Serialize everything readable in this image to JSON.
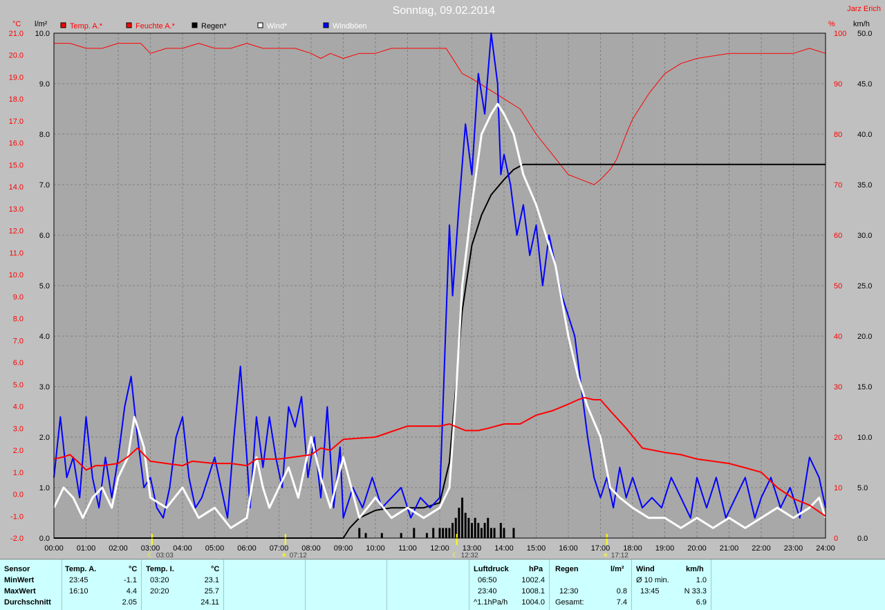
{
  "title": "Sonntag, 09.02.2014",
  "author": "Jarz Erich",
  "units": {
    "left1": "°C",
    "left2": "l/m²",
    "right1": "%",
    "right2": "km/h"
  },
  "legend": [
    {
      "label": "Temp. A.*",
      "color": "#ff0000"
    },
    {
      "label": "Feuchte A.*",
      "color": "#ff0000"
    },
    {
      "label": "Regen*",
      "color": "#000000"
    },
    {
      "label": "Wind*",
      "color": "#ffffff"
    },
    {
      "label": "Windböen",
      "color": "#0000ff"
    }
  ],
  "markers": [
    {
      "time": "03:03",
      "h": 3.05,
      "symbol": "moon"
    },
    {
      "time": "07:12",
      "h": 7.2,
      "symbol": "sun"
    },
    {
      "time": "12:32",
      "h": 12.53,
      "symbol": "moon"
    },
    {
      "time": "17:12",
      "h": 17.2,
      "symbol": "sun"
    }
  ],
  "chart_data": {
    "type": "line",
    "x_axis": {
      "label": "",
      "ticks": [
        "00:00",
        "01:00",
        "02:00",
        "03:00",
        "04:00",
        "05:00",
        "06:00",
        "07:00",
        "08:00",
        "09:00",
        "10:00",
        "11:00",
        "12:00",
        "13:00",
        "14:00",
        "15:00",
        "16:00",
        "17:00",
        "18:00",
        "19:00",
        "20:00",
        "21:00",
        "22:00",
        "23:00",
        "24:00"
      ],
      "range": [
        0,
        24
      ]
    },
    "axes": {
      "temp": {
        "unit": "°C",
        "range": [
          -2.0,
          21.0
        ],
        "ticks": [
          "21.0",
          "20.0",
          "19.0",
          "18.0",
          "17.0",
          "16.0",
          "15.0",
          "14.0",
          "13.0",
          "12.0",
          "11.0",
          "10.0",
          "9.0",
          "8.0",
          "7.0",
          "6.0",
          "5.0",
          "4.0",
          "3.0",
          "2.0",
          "1.0",
          "0.0",
          "-1.0",
          "-2.0"
        ]
      },
      "rain": {
        "unit": "l/m²",
        "range": [
          0.0,
          10.0
        ],
        "ticks": [
          "10.0",
          "9.0",
          "8.0",
          "7.0",
          "6.0",
          "5.0",
          "4.0",
          "3.0",
          "2.0",
          "1.0",
          "0.0"
        ]
      },
      "humidity": {
        "unit": "%",
        "range": [
          0,
          100
        ],
        "ticks": [
          "100",
          "90",
          "80",
          "70",
          "60",
          "50",
          "40",
          "30",
          "20",
          "10",
          "0"
        ]
      },
      "wind": {
        "unit": "km/h",
        "range": [
          0.0,
          50.0
        ],
        "ticks": [
          "50.0",
          "45.0",
          "40.0",
          "35.0",
          "30.0",
          "25.0",
          "20.0",
          "15.0",
          "10.0",
          "5.0",
          "0.0"
        ]
      }
    },
    "grid": true,
    "series": [
      {
        "name": "Temp. A.*",
        "axis": "temp",
        "color": "#ff0000",
        "x": [
          0,
          0.3,
          0.5,
          0.8,
          1.0,
          1.3,
          1.5,
          2.0,
          2.3,
          2.6,
          3.0,
          3.5,
          4.0,
          4.3,
          5.0,
          5.5,
          6.0,
          6.3,
          6.6,
          7.0,
          7.5,
          8.0,
          8.3,
          8.6,
          9.0,
          10.0,
          11.0,
          12.0,
          12.3,
          12.8,
          13.2,
          13.5,
          14.0,
          14.5,
          15.0,
          15.5,
          16.0,
          16.3,
          16.5,
          16.8,
          17.0,
          17.3,
          17.8,
          18.3,
          19.0,
          19.5,
          20.0,
          21.0,
          21.5,
          22.0,
          22.5,
          23.0,
          23.5,
          24.0
        ],
        "y": [
          1.6,
          1.7,
          1.8,
          1.4,
          1.1,
          1.3,
          1.3,
          1.4,
          1.7,
          2.1,
          1.5,
          1.4,
          1.3,
          1.5,
          1.4,
          1.4,
          1.3,
          1.6,
          1.6,
          1.6,
          1.7,
          1.8,
          2.1,
          2.0,
          2.5,
          2.6,
          3.1,
          3.1,
          3.2,
          2.9,
          2.9,
          3.0,
          3.2,
          3.2,
          3.6,
          3.8,
          4.1,
          4.3,
          4.4,
          4.3,
          4.3,
          3.8,
          3.0,
          2.1,
          1.9,
          1.8,
          1.6,
          1.4,
          1.2,
          1.0,
          0.3,
          -0.2,
          -0.5,
          -1.0
        ]
      },
      {
        "name": "Feuchte A.*",
        "axis": "humidity",
        "color": "#ff0000",
        "x": [
          0,
          0.5,
          1.0,
          1.5,
          2.0,
          2.5,
          2.7,
          3.0,
          3.5,
          4.0,
          4.5,
          5.0,
          5.5,
          6.0,
          6.5,
          7.0,
          7.5,
          8.0,
          8.3,
          8.6,
          9.0,
          9.5,
          10.0,
          10.5,
          11.0,
          11.5,
          12.0,
          12.2,
          12.5,
          12.7,
          13.0,
          13.5,
          14.0,
          14.5,
          15.0,
          15.5,
          16.0,
          16.4,
          16.8,
          17.0,
          17.3,
          17.5,
          17.8,
          18.0,
          18.5,
          19.0,
          19.5,
          20.0,
          21.0,
          22.0,
          23.0,
          23.5,
          24.0
        ],
        "y": [
          98,
          98,
          97,
          97,
          98,
          98,
          98,
          96,
          97,
          97,
          98,
          97,
          97,
          98,
          97,
          97,
          97,
          96,
          95,
          96,
          95,
          96,
          96,
          97,
          97,
          97,
          97,
          97,
          94,
          92,
          91,
          89,
          87,
          85,
          80,
          76,
          72,
          71,
          70,
          71,
          73,
          75,
          80,
          83,
          88,
          92,
          94,
          95,
          96,
          96,
          96,
          97,
          96
        ]
      },
      {
        "name": "Regen*",
        "axis": "rain",
        "color": "#000000",
        "x": [
          0,
          9.0,
          9.2,
          9.5,
          10.0,
          10.5,
          11.0,
          11.5,
          12.0,
          12.3,
          12.5,
          12.7,
          13.0,
          13.3,
          13.6,
          14.0,
          14.3,
          14.6,
          15.0,
          16.0,
          17.0,
          24.0
        ],
        "y": [
          0,
          0,
          0.2,
          0.4,
          0.55,
          0.6,
          0.6,
          0.6,
          0.7,
          1.5,
          3.0,
          4.5,
          5.8,
          6.4,
          6.8,
          7.1,
          7.3,
          7.4,
          7.4,
          7.4,
          7.4,
          7.4
        ]
      },
      {
        "name": "Wind*",
        "axis": "wind",
        "color": "#ffffff",
        "x": [
          0,
          0.3,
          0.6,
          0.9,
          1.2,
          1.5,
          1.8,
          2.0,
          2.3,
          2.5,
          2.8,
          3.0,
          3.5,
          4.0,
          4.5,
          5.0,
          5.5,
          6.0,
          6.3,
          6.5,
          6.7,
          7.0,
          7.3,
          7.6,
          8.0,
          8.3,
          8.6,
          9.0,
          9.5,
          10.0,
          10.5,
          11.0,
          11.5,
          12.0,
          12.3,
          12.5,
          12.7,
          13.0,
          13.3,
          13.6,
          13.8,
          14.0,
          14.3,
          14.6,
          15.0,
          15.3,
          15.6,
          16.0,
          16.3,
          16.6,
          17.0,
          17.3,
          17.6,
          18.0,
          18.5,
          19.0,
          19.5,
          20.0,
          20.5,
          21.0,
          21.5,
          22.0,
          22.5,
          23.0,
          23.5,
          23.8,
          24.0
        ],
        "y": [
          3,
          5,
          4,
          2,
          4,
          5,
          3,
          6,
          8,
          12,
          9,
          4,
          3,
          5,
          2,
          3,
          1,
          2,
          8,
          5,
          3,
          5,
          7,
          4,
          10,
          6,
          3,
          8,
          2,
          4,
          2,
          3,
          2,
          3,
          5,
          14,
          25,
          33,
          40,
          42,
          43,
          42,
          40,
          36,
          33,
          30,
          27,
          20,
          16,
          13,
          10,
          5,
          4,
          3,
          2,
          2,
          1,
          2,
          1,
          2,
          1,
          2,
          3,
          2,
          3,
          4,
          2
        ]
      },
      {
        "name": "Windböen",
        "axis": "wind",
        "color": "#0000ff",
        "x": [
          0,
          0.2,
          0.4,
          0.6,
          0.8,
          1.0,
          1.2,
          1.4,
          1.6,
          1.8,
          2.0,
          2.2,
          2.4,
          2.6,
          2.8,
          3.0,
          3.2,
          3.4,
          3.6,
          3.8,
          4.0,
          4.2,
          4.4,
          4.6,
          4.8,
          5.0,
          5.2,
          5.4,
          5.6,
          5.8,
          6.0,
          6.1,
          6.3,
          6.5,
          6.7,
          6.9,
          7.1,
          7.3,
          7.5,
          7.7,
          7.9,
          8.1,
          8.3,
          8.5,
          8.7,
          8.9,
          9.0,
          9.3,
          9.6,
          9.9,
          10.2,
          10.5,
          10.8,
          11.1,
          11.4,
          11.7,
          12.0,
          12.2,
          12.3,
          12.4,
          12.6,
          12.8,
          13.0,
          13.2,
          13.4,
          13.6,
          13.8,
          13.9,
          14.0,
          14.2,
          14.4,
          14.6,
          14.8,
          15.0,
          15.2,
          15.4,
          15.6,
          15.8,
          16.0,
          16.2,
          16.4,
          16.6,
          16.8,
          17.0,
          17.2,
          17.4,
          17.6,
          17.8,
          18.0,
          18.3,
          18.6,
          18.9,
          19.2,
          19.5,
          19.8,
          20.0,
          20.3,
          20.6,
          20.9,
          21.2,
          21.5,
          21.8,
          22.0,
          22.3,
          22.6,
          22.9,
          23.2,
          23.5,
          23.8,
          24.0
        ],
        "y": [
          6,
          12,
          6,
          8,
          4,
          12,
          6,
          3,
          8,
          4,
          8,
          13,
          16,
          10,
          5,
          6,
          3,
          2,
          5,
          10,
          12,
          6,
          3,
          4,
          6,
          8,
          5,
          2,
          10,
          17,
          8,
          3,
          12,
          7,
          12,
          8,
          5,
          13,
          11,
          14,
          6,
          10,
          4,
          13,
          3,
          9,
          2,
          5,
          3,
          6,
          3,
          4,
          5,
          2,
          4,
          3,
          4,
          22,
          31,
          24,
          33,
          41,
          36,
          46,
          42,
          50,
          45,
          36,
          38,
          35,
          30,
          33,
          28,
          31,
          25,
          30,
          27,
          24,
          22,
          20,
          15,
          10,
          6,
          4,
          6,
          3,
          7,
          4,
          6,
          3,
          4,
          3,
          6,
          4,
          2,
          6,
          3,
          6,
          2,
          4,
          6,
          2,
          4,
          6,
          3,
          5,
          2,
          8,
          6,
          3
        ]
      }
    ],
    "rain_bars": {
      "x": [
        9.5,
        9.7,
        10.2,
        10.8,
        11.2,
        11.6,
        11.8,
        12.0,
        12.1,
        12.2,
        12.3,
        12.4,
        12.5,
        12.6,
        12.7,
        12.8,
        12.9,
        13.0,
        13.1,
        13.2,
        13.3,
        13.4,
        13.5,
        13.6,
        13.7,
        13.9,
        14.0,
        14.3
      ],
      "y": [
        0.2,
        0.1,
        0.1,
        0.1,
        0.2,
        0.1,
        0.2,
        0.2,
        0.2,
        0.2,
        0.2,
        0.3,
        0.4,
        0.6,
        0.8,
        0.5,
        0.4,
        0.3,
        0.4,
        0.3,
        0.2,
        0.3,
        0.4,
        0.2,
        0.2,
        0.3,
        0.2,
        0.2
      ]
    }
  },
  "stats": {
    "sensor": {
      "header": "Sensor",
      "rows": [
        "MinWert",
        "MaxWert",
        "Durchschnitt"
      ]
    },
    "temp_a": {
      "header": "Temp. A.",
      "unit": "°C",
      "min_time": "23:45",
      "min": "-1.1",
      "max_time": "16:10",
      "max": "4.4",
      "avg": "2.05"
    },
    "temp_i": {
      "header": "Temp. I.",
      "unit": "°C",
      "min_time": "03:20",
      "min": "23.1",
      "max_time": "20:20",
      "max": "25.7",
      "avg": "24.11"
    },
    "pressure": {
      "header": "Luftdruck",
      "unit": "hPa",
      "min_time": "06:50",
      "min": "1002.4",
      "max_time": "23:40",
      "max": "1008.1",
      "avg_label": "^1.1hPa/h",
      "avg": "1004.0"
    },
    "rain": {
      "header": "Regen",
      "unit": "l/m²",
      "max_time": "12:30",
      "max": "0.8",
      "total_label": "Gesamt:",
      "total": "7.4"
    },
    "wind": {
      "header": "Wind",
      "unit": "km/h",
      "min_label": "Ø 10 min.",
      "min": "1.0",
      "max_time": "13:45",
      "max": "N 33.3",
      "avg": "6.9"
    }
  }
}
